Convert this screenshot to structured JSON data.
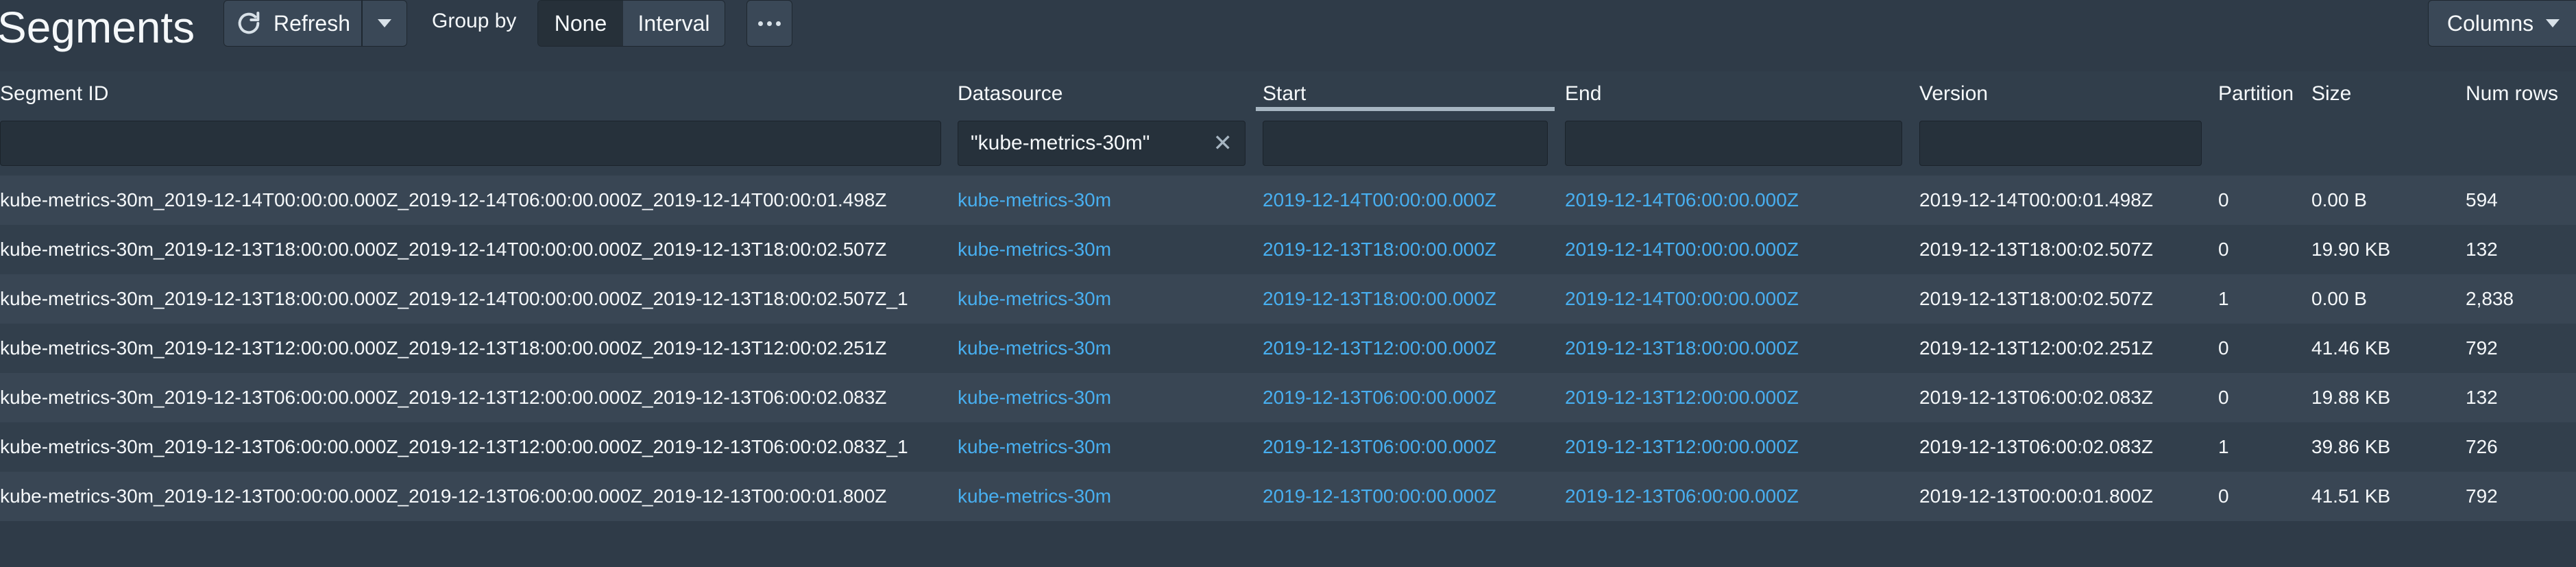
{
  "header": {
    "title": "Segments",
    "refresh_label": "Refresh",
    "group_by_label": "Group by",
    "group_none": "None",
    "group_interval": "Interval",
    "columns_label": "Columns"
  },
  "columns": [
    "Segment ID",
    "Datasource",
    "Start",
    "End",
    "Version",
    "Partition",
    "Size",
    "Num rows"
  ],
  "filters": {
    "segment_id": "",
    "datasource": "\"kube-metrics-30m\"",
    "start": "",
    "end": "",
    "version": ""
  },
  "rows": [
    {
      "segment_id": "kube-metrics-30m_2019-12-14T00:00:00.000Z_2019-12-14T06:00:00.000Z_2019-12-14T00:00:01.498Z",
      "datasource": "kube-metrics-30m",
      "start": "2019-12-14T00:00:00.000Z",
      "end": "2019-12-14T06:00:00.000Z",
      "version": "2019-12-14T00:00:01.498Z",
      "partition": "0",
      "size": "0.00 B",
      "num_rows": "594"
    },
    {
      "segment_id": "kube-metrics-30m_2019-12-13T18:00:00.000Z_2019-12-14T00:00:00.000Z_2019-12-13T18:00:02.507Z",
      "datasource": "kube-metrics-30m",
      "start": "2019-12-13T18:00:00.000Z",
      "end": "2019-12-14T00:00:00.000Z",
      "version": "2019-12-13T18:00:02.507Z",
      "partition": "0",
      "size": "19.90 KB",
      "num_rows": "132"
    },
    {
      "segment_id": "kube-metrics-30m_2019-12-13T18:00:00.000Z_2019-12-14T00:00:00.000Z_2019-12-13T18:00:02.507Z_1",
      "datasource": "kube-metrics-30m",
      "start": "2019-12-13T18:00:00.000Z",
      "end": "2019-12-14T00:00:00.000Z",
      "version": "2019-12-13T18:00:02.507Z",
      "partition": "1",
      "size": "0.00 B",
      "num_rows": "2,838"
    },
    {
      "segment_id": "kube-metrics-30m_2019-12-13T12:00:00.000Z_2019-12-13T18:00:00.000Z_2019-12-13T12:00:02.251Z",
      "datasource": "kube-metrics-30m",
      "start": "2019-12-13T12:00:00.000Z",
      "end": "2019-12-13T18:00:00.000Z",
      "version": "2019-12-13T12:00:02.251Z",
      "partition": "0",
      "size": "41.46 KB",
      "num_rows": "792"
    },
    {
      "segment_id": "kube-metrics-30m_2019-12-13T06:00:00.000Z_2019-12-13T12:00:00.000Z_2019-12-13T06:00:02.083Z",
      "datasource": "kube-metrics-30m",
      "start": "2019-12-13T06:00:00.000Z",
      "end": "2019-12-13T12:00:00.000Z",
      "version": "2019-12-13T06:00:02.083Z",
      "partition": "0",
      "size": "19.88 KB",
      "num_rows": "132"
    },
    {
      "segment_id": "kube-metrics-30m_2019-12-13T06:00:00.000Z_2019-12-13T12:00:00.000Z_2019-12-13T06:00:02.083Z_1",
      "datasource": "kube-metrics-30m",
      "start": "2019-12-13T06:00:00.000Z",
      "end": "2019-12-13T12:00:00.000Z",
      "version": "2019-12-13T06:00:02.083Z",
      "partition": "1",
      "size": "39.86 KB",
      "num_rows": "726"
    },
    {
      "segment_id": "kube-metrics-30m_2019-12-13T00:00:00.000Z_2019-12-13T06:00:00.000Z_2019-12-13T00:00:01.800Z",
      "datasource": "kube-metrics-30m",
      "start": "2019-12-13T00:00:00.000Z",
      "end": "2019-12-13T06:00:00.000Z",
      "version": "2019-12-13T00:00:01.800Z",
      "partition": "0",
      "size": "41.51 KB",
      "num_rows": "792"
    }
  ],
  "colors": {
    "background": "#2f3b48",
    "link": "#48aff0",
    "row_odd": "#394654",
    "row_even": "#323f4c"
  },
  "icons": {
    "refresh": "refresh-icon",
    "dropdown": "caret-down-icon",
    "more": "more-icon",
    "clear": "clear-icon"
  }
}
